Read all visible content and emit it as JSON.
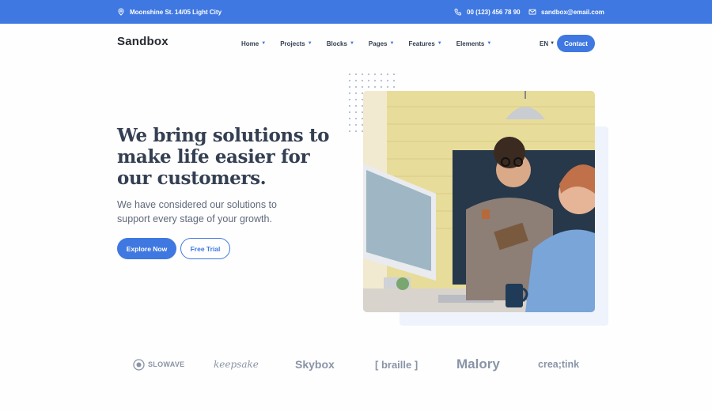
{
  "topbar": {
    "address": "Moonshine St. 14/05 Light City",
    "phone": "00 (123) 456 78 90",
    "email": "sandbox@email.com",
    "icons": [
      "map-pin-icon",
      "phone-icon",
      "email-icon"
    ]
  },
  "navbar": {
    "logo": "Sandbox",
    "items": [
      {
        "label": "Home"
      },
      {
        "label": "Projects"
      },
      {
        "label": "Blocks"
      },
      {
        "label": "Pages"
      },
      {
        "label": "Features"
      },
      {
        "label": "Elements"
      }
    ],
    "language": "EN",
    "contact_label": "Contact"
  },
  "hero": {
    "title": "We bring solutions to make life easier for our customers.",
    "subtitle": "We have considered our solutions to support every stage of your growth.",
    "primary_button": "Explore Now",
    "secondary_button": "Free Trial"
  },
  "clients": {
    "logos": [
      "SLOWAVE",
      "keepsake",
      "Skybox",
      "[ braille ]",
      "Malory",
      "crea;tink"
    ]
  },
  "colors": {
    "primary": "#3f78e0",
    "heading": "#343f52",
    "body_text": "#60697b",
    "logo_gray": "#8a94a6",
    "photo_shadow": "#eff3fc"
  }
}
